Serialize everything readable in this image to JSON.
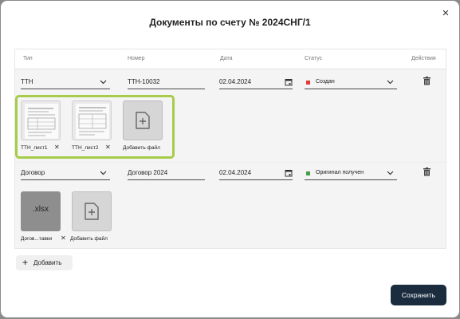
{
  "dialog": {
    "title": "Документы по счету № 2024СНГ/1",
    "close_label": "×"
  },
  "columns": [
    "Тип",
    "Номер",
    "Дата",
    "Статус",
    "Действия"
  ],
  "rows": [
    {
      "type": "ТТН",
      "number": "ТТН-10032",
      "date": "02.04.2024",
      "status": "Создан",
      "status_color": "#e53935",
      "files": [
        {
          "name": "ТТН_лист1",
          "kind": "scan"
        },
        {
          "name": "ТТН_лист2",
          "kind": "scan"
        }
      ],
      "add_file_label": "Добавить файл"
    },
    {
      "type": "Договор",
      "number": "Договор 2024",
      "date": "02.04.2024",
      "status": "Оригинал получен",
      "status_color": "#43a047",
      "files": [
        {
          "name": "Догов...тавки",
          "kind": "xlsx",
          "ext": ".xlsx"
        }
      ],
      "add_file_label": "Добавить файл"
    }
  ],
  "actions": {
    "add_label": "Добавить",
    "save_label": "Сохранить"
  },
  "colors": {
    "primary": "#1b2c3f",
    "highlight": "#a6cc4a"
  }
}
